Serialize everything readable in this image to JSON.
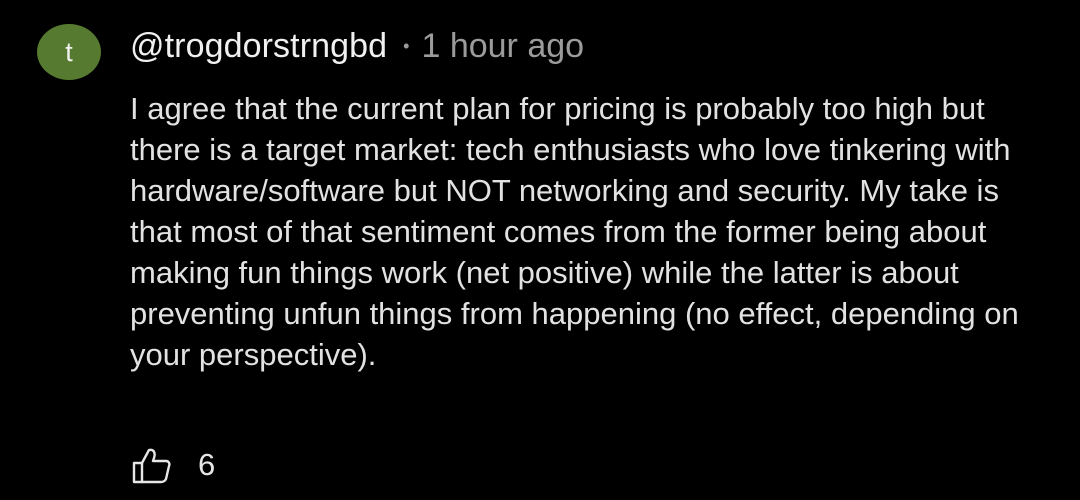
{
  "comment": {
    "avatar_letter": "t",
    "avatar_color": "#567a2f",
    "author": "@trogdorstrngbd",
    "separator": "•",
    "time": "1 hour ago",
    "body": "I agree that the current plan for pricing is probably too high but there is a target market: tech enthusiasts who love tinkering with hardware/software but NOT networking and security. My take is that most of that sentiment comes from the former being about making fun things work (net positive) while the latter is about preventing unfun things from happening (no effect, depending on your perspective).",
    "like_icon": "thumbs-up-icon",
    "like_count": "6"
  }
}
